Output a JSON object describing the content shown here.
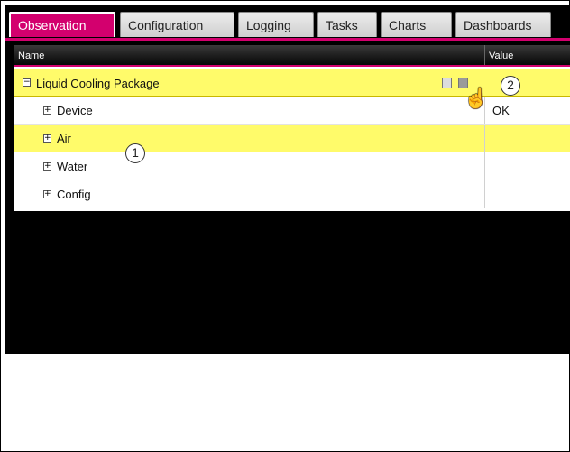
{
  "tabs": [
    {
      "label": "Observation",
      "active": true
    },
    {
      "label": "Configuration",
      "active": false
    },
    {
      "label": "Logging",
      "active": false
    },
    {
      "label": "Tasks",
      "active": false
    },
    {
      "label": "Charts",
      "active": false
    },
    {
      "label": "Dashboards",
      "active": false
    }
  ],
  "grid": {
    "columns": {
      "name": "Name",
      "value": "Value"
    },
    "root": {
      "label": "Liquid Cooling Package",
      "expander": "−",
      "icons": [
        "edit-icon",
        "delete-icon"
      ]
    },
    "children": [
      {
        "label": "Device",
        "expander": "+",
        "value": "OK"
      },
      {
        "label": "Air",
        "expander": "+",
        "value": ""
      },
      {
        "label": "Water",
        "expander": "+",
        "value": ""
      },
      {
        "label": "Config",
        "expander": "+",
        "value": ""
      }
    ]
  },
  "callouts": {
    "first": "1",
    "second": "2"
  },
  "colors": {
    "accent": "#d3006e",
    "highlight": "#fffb6a",
    "background": "#000000"
  }
}
